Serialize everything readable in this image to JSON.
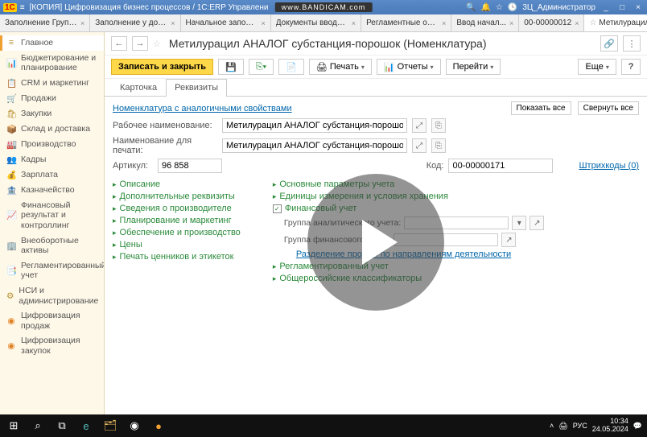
{
  "titlebar": {
    "logo": "1C",
    "title": "[КОПИЯ] Цифровизация бизнес процессов / 1С:ERP Управлени",
    "bandicam": "www.BANDICAM.com",
    "user": "3Ц_Администратор"
  },
  "tabs": [
    {
      "label": "Заполнение ГруппыФУ Н..."
    },
    {
      "label": "Заполнение у договоров..."
    },
    {
      "label": "Начальное заполнение"
    },
    {
      "label": "Документы ввода начал..."
    },
    {
      "label": "Регламентные операции ..."
    },
    {
      "label": "Ввод начал..."
    },
    {
      "label": "00-00000012"
    },
    {
      "label": "Метилурацил АНАЛОГ с...",
      "active": true
    }
  ],
  "sidebar": [
    {
      "icon": "≡",
      "label": "Главное",
      "active": true
    },
    {
      "icon": "📊",
      "label": "Бюджетирование и планирование"
    },
    {
      "icon": "📋",
      "label": "CRM и маркетинг"
    },
    {
      "icon": "🛒",
      "label": "Продажи"
    },
    {
      "icon": "🛍",
      "label": "Закупки"
    },
    {
      "icon": "📦",
      "label": "Склад и доставка"
    },
    {
      "icon": "🏭",
      "label": "Производство"
    },
    {
      "icon": "👥",
      "label": "Кадры"
    },
    {
      "icon": "💰",
      "label": "Зарплата"
    },
    {
      "icon": "🏦",
      "label": "Казначейство"
    },
    {
      "icon": "📈",
      "label": "Финансовый результат и контроллинг"
    },
    {
      "icon": "🏢",
      "label": "Внеоборотные активы"
    },
    {
      "icon": "📑",
      "label": "Регламентированный учет"
    },
    {
      "icon": "⚙",
      "label": "НСИ и администрирование"
    },
    {
      "icon": "◉",
      "label": "Цифровизация продаж",
      "orange": true
    },
    {
      "icon": "◉",
      "label": "Цифровизация закупок",
      "orange": true
    }
  ],
  "page": {
    "title": "Метилурацил АНАЛОГ субстанция-порошок (Номенклатура)",
    "save_close": "Записать и закрыть",
    "print": "Печать",
    "reports": "Отчеты",
    "goto": "Перейти",
    "more": "Еще",
    "help": "?"
  },
  "subtabs": {
    "card": "Карточка",
    "req": "Реквизиты"
  },
  "form": {
    "similar_link": "Номенклатура с аналогичными свойствами",
    "show_all": "Показать все",
    "collapse_all": "Свернуть все",
    "work_name_label": "Рабочее наименование:",
    "work_name": "Метилурацил АНАЛОГ субстанция-порошок",
    "print_name_label": "Наименование для печати:",
    "print_name": "Метилурацил АНАЛОГ субстанция-порошок",
    "art_label": "Артикул:",
    "art": "96 858",
    "code_label": "Код:",
    "code": "00-00000171",
    "barcodes": "Штрихкоды (0)",
    "left_items": [
      "Описание",
      "Дополнительные реквизиты",
      "Сведения о производителе",
      "Планирование и маркетинг",
      "Обеспечение и производство",
      "Цены",
      "Печать ценников и этикеток"
    ],
    "right_items": [
      {
        "label": "Основные параметры учета"
      },
      {
        "label": "Единицы измерения и условия хранения"
      },
      {
        "label": "Финансовый учет",
        "checked": true,
        "expanded": true
      },
      {
        "label": "Разделение продаж по направлениям деятельности",
        "sublink": true
      },
      {
        "label": "Регламентированный учет",
        "obscured": true
      },
      {
        "label": "Общероссийские классификаторы"
      }
    ],
    "grp_analit": "Группа аналитического учета:",
    "grp_fin": "Группа финансового учета:"
  },
  "taskbar": {
    "time": "10:34",
    "date": "24.05.2024",
    "lang": "РУС"
  }
}
